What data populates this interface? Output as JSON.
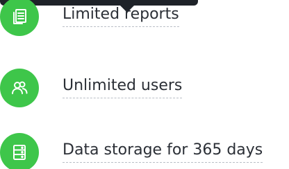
{
  "accent_color": "#3ec64a",
  "tooltip": {
    "visible": true
  },
  "features": [
    {
      "icon": "reports-icon",
      "label": "Limited reports"
    },
    {
      "icon": "users-icon",
      "label": "Unlimited users"
    },
    {
      "icon": "storage-icon",
      "label": "Data storage for 365 days"
    }
  ]
}
